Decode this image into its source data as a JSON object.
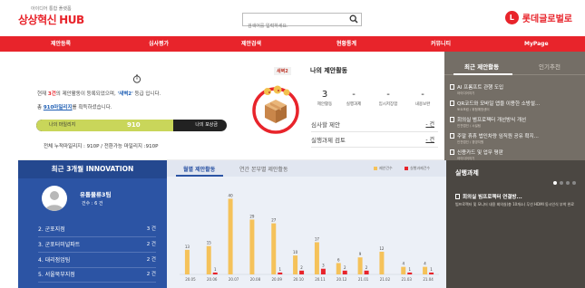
{
  "header": {
    "tagline": "아이디어 통합 플랫폼",
    "logo_text": "상상혁신",
    "logo_hub": "HUB",
    "search_placeholder": "검색어를 입력하세요.",
    "brand_name": "롯데글로벌로",
    "brand_mark": "L",
    "brand_color": "#e8242b"
  },
  "nav": {
    "items": [
      "제안등록",
      "심사평가",
      "제안검색",
      "현황통계",
      "커뮤니티",
      "MyPage"
    ]
  },
  "status": {
    "line1_pre": "현재 ",
    "line1_count": "3건",
    "line1_mid": "의 제안활동이 등록되었으며, ",
    "line1_grade": "'새벽2'",
    "line1_post": " 등급 입니다.",
    "line2_pre": "총 ",
    "line2_mileage": "910마일리지",
    "line2_post": "를 획득하셨습니다.",
    "mileage_label": "나의 마일리지",
    "mileage_value": "910",
    "mileage_right": "나의 포상금",
    "mileage_fraction": 0.72,
    "summary": "전체 누적마일리지 : 910P / 전환가능 마일리지 :910P",
    "grade_badge": "새벽2"
  },
  "activity": {
    "title": "나의 제안활동",
    "stats": [
      {
        "value": "3",
        "label": "제안활동"
      },
      {
        "value": "-",
        "label": "실행과제"
      },
      {
        "value": "-",
        "label": "임시저장함"
      },
      {
        "value": "-",
        "label": "내용보완"
      }
    ],
    "rows": [
      {
        "label": "심사할 제안",
        "count": "- 건"
      },
      {
        "label": "실행과제 검토",
        "count": "- 건"
      }
    ]
  },
  "recent": {
    "tab_active": "최근 제안활동",
    "tab_inactive": "인기추천",
    "items": [
      {
        "title": "AI 프롬프트 관행 도입",
        "sub": "아이디어지기"
      },
      {
        "title": "QR코드와 모바일 앱을 이용한 소방설...",
        "sub": "토요포럼 / 위험예방센터"
      },
      {
        "title": "회의실 범프로젝터 개선방식 개선",
        "sub": "인천법인 / 시설팀"
      },
      {
        "title": "주말 휴휴 법인차량 임직원 공유 확지...",
        "sub": "인천법인 / 경영지원"
      },
      {
        "title": "신용카드 및 업무 평판",
        "sub": "아이디어지기"
      }
    ]
  },
  "innovation": {
    "title": "최근 3개월 INNOVATION",
    "top_name": "유통물류3팀",
    "top_count": "건수 : 6 건",
    "ranks": [
      {
        "label": "2. 군포지점",
        "count": "3 건"
      },
      {
        "label": "3. 군포터미널파트",
        "count": "2 건"
      },
      {
        "label": "4. 대리점업팀",
        "count": "2 건"
      },
      {
        "label": "5. 서울북부지점",
        "count": "2 건"
      }
    ]
  },
  "chart_tabs": {
    "active": "월별 제안활동",
    "inactive": "연간 본부별 제안활동"
  },
  "chart_data": {
    "type": "bar",
    "categories": [
      "20.05",
      "20.06",
      "20.07",
      "20.08",
      "20.09",
      "20.10",
      "20.11",
      "20.12",
      "21.01",
      "21.02",
      "21.03",
      "21.04"
    ],
    "series": [
      {
        "name": "제안건수",
        "color": "#f5c25a",
        "values": [
          13,
          15,
          40,
          29,
          27,
          10,
          17,
          6,
          9,
          12,
          4,
          4
        ]
      },
      {
        "name": "실행과제건수",
        "color": "#e8242b",
        "values": [
          0,
          1,
          0,
          0,
          1,
          2,
          3,
          2,
          2,
          0,
          1,
          1
        ]
      }
    ],
    "title": "",
    "xlabel": "",
    "ylabel": "",
    "ylim": [
      0,
      45
    ]
  },
  "exec": {
    "title": "실행과제",
    "item_title": "회의실 빔프로젝터 연결방...",
    "item_desc": "빔프로젝터 및 모니터 내용 회의실(총 10개소) 무선 HDMI 동시인식 부착 완료"
  }
}
